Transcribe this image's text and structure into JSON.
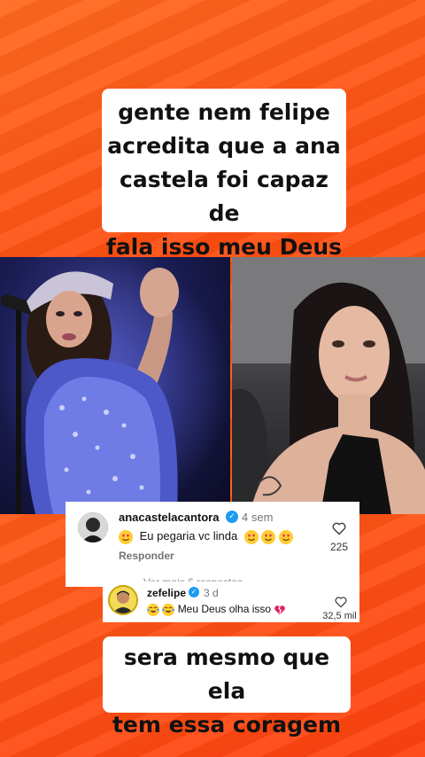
{
  "captions": {
    "top": [
      "gente nem felipe",
      "acredita que a ana",
      "castela foi capaz de",
      "fala isso meu Deus"
    ],
    "bottom": [
      "sera mesmo que ela",
      "tem essa coragem"
    ]
  },
  "comment": {
    "username": "anacastelacantora",
    "time": "4 sem",
    "text": "Eu pegaria vc linda",
    "likes": "225",
    "reply_label": "Responder",
    "see_more": "Ver mais 6 respostas"
  },
  "reply": {
    "username": "zefelipe",
    "time": "3 d",
    "text": "Meu Deus olha isso",
    "likes": "32,5 mil"
  },
  "colors": {
    "background": "#ff5a18",
    "verified": "#1d9bf0",
    "broken_heart": "#e0245e"
  },
  "icons": [
    "verified-badge-icon",
    "heart-outline-icon",
    "heart-eyes-emoji",
    "laughing-tears-emoji",
    "broken-heart-emoji"
  ]
}
